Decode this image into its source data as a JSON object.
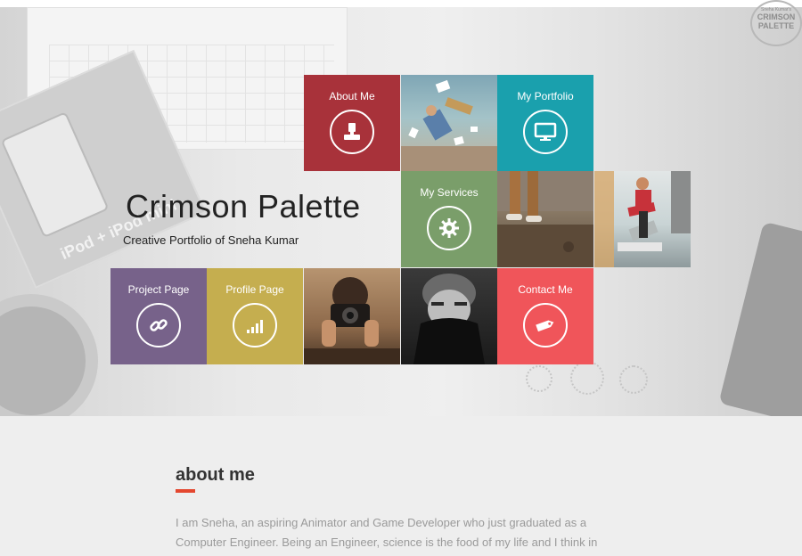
{
  "brand": {
    "logo_small": "Sneha Kumar's",
    "logo_line1": "CRIMSON",
    "logo_line2": "PALETTE"
  },
  "hero": {
    "title": "Crimson Palette",
    "subtitle": "Creative Portfolio of Sneha Kumar",
    "box_text": "iPod + iPod mini"
  },
  "tiles": {
    "about": {
      "label": "About Me",
      "color": "#a8323a",
      "icon": "user-icon"
    },
    "portfolio": {
      "label": "My Portfolio",
      "color": "#1aa0ad",
      "icon": "monitor-icon"
    },
    "services": {
      "label": "My Services",
      "color": "#7a9e6a",
      "icon": "gear-icon"
    },
    "project": {
      "label": "Project Page",
      "color": "#77628a",
      "icon": "link-icon"
    },
    "profile": {
      "label": "Profile Page",
      "color": "#c5ae4f",
      "icon": "chart-icon"
    },
    "contact": {
      "label": "Contact Me",
      "color": "#f0555a",
      "icon": "tag-icon"
    }
  },
  "about": {
    "heading": "about me",
    "text_line1": "I am Sneha, an aspiring Animator and Game Developer who just graduated as a",
    "text_line2": "Computer Engineer. Being an Engineer, science is the food of my life and I think in"
  }
}
